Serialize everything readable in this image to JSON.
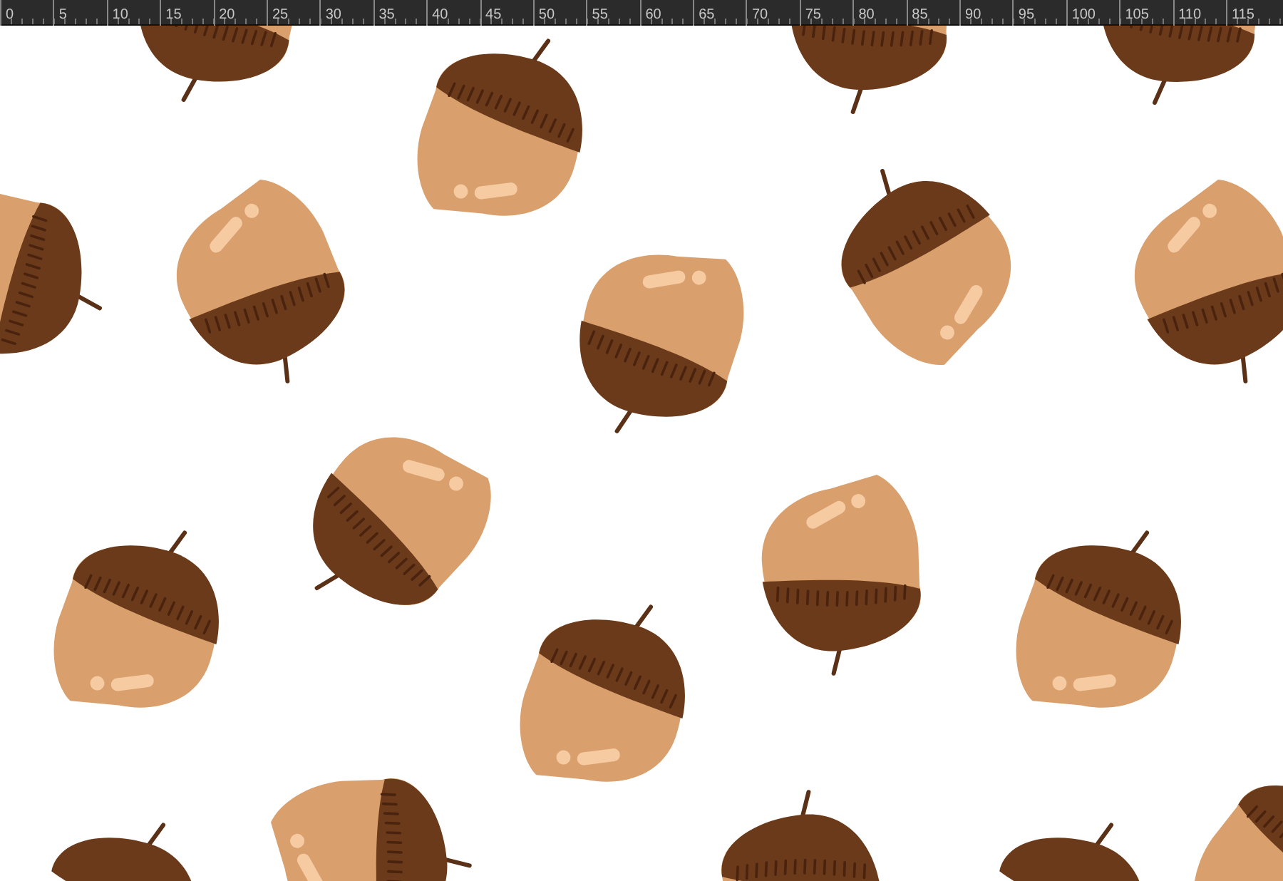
{
  "ruler": {
    "labels": [
      "0",
      "5",
      "10",
      "15",
      "20",
      "25",
      "30",
      "35",
      "40",
      "45",
      "50",
      "55",
      "60",
      "65",
      "70",
      "75",
      "80",
      "85",
      "90",
      "95",
      "100",
      "105",
      "110",
      "115"
    ]
  }
}
